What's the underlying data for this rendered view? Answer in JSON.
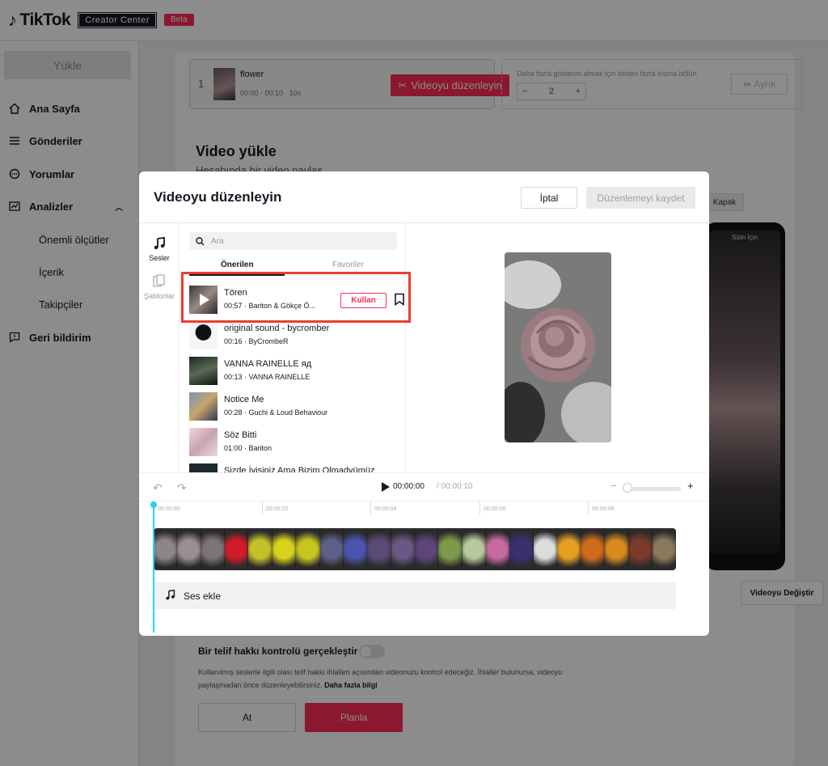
{
  "brand": {
    "name": "TikTok",
    "creator_center": "Creator Center",
    "beta": "Beta"
  },
  "sidebar": {
    "upload": "Yükle",
    "items": [
      {
        "label": "Ana Sayfa",
        "icon": "home-icon"
      },
      {
        "label": "Gönderiler",
        "icon": "list-icon"
      },
      {
        "label": "Yorumlar",
        "icon": "comment-icon"
      },
      {
        "label": "Analizler",
        "icon": "analytics-icon"
      },
      {
        "label": "Geri bildirim",
        "icon": "feedback-icon"
      }
    ],
    "analytics_sub": [
      "Önemli ölçütler",
      "İçerik",
      "Takipçiler"
    ]
  },
  "clip": {
    "index": "1",
    "name": "flower",
    "time": "00:00 - 00:10",
    "duration": "10s",
    "edit_button": "Videoyu düzenleyin",
    "split_hint": "Daha fazla gösterim almak için birden fazla kısma bölün",
    "split_count": "2",
    "split_button": "Ayrık"
  },
  "upload": {
    "title": "Video yükle",
    "subtitle": "Hesabında bir video paylaş",
    "cover_button": "Kapak",
    "phone_tab": "Sizin İçin",
    "replace_button": "Videoyu Değiştir",
    "copyright_title": "Bir telif hakkı kontrolü gerçekleştir",
    "copyright_desc": "Kullanılmış seslerle ilgili olası telif hakkı ihlalleri açısından videonuzu kontrol edeceğiz. İhlaller bulunursa, videoyu paylaşmadan önce düzenleyebilirsiniz.",
    "copyright_link": "Daha fazla bilgi",
    "discard": "At",
    "post": "Planla"
  },
  "modal": {
    "title": "Videoyu düzenleyin",
    "cancel": "İptal",
    "save": "Düzenlemeyi kaydet",
    "rail": {
      "sounds": "Sesler",
      "templates": "Şablonlar"
    },
    "search_placeholder": "Ara",
    "tabs": {
      "recommended": "Önerilen",
      "favorites": "Favoriler"
    },
    "use_button": "Kullan",
    "songs": [
      {
        "title": "Tören",
        "meta": "00:57 · Bariton & Gökçe Ö..."
      },
      {
        "title": "original sound - bycromber",
        "meta": "00:16 · ByCrombeR"
      },
      {
        "title": "VANNA RAINELLE яд",
        "meta": "00:13 · VANNA RAINELLE"
      },
      {
        "title": "Notice Me",
        "meta": "00:28 · Guchi & Loud Behaviour"
      },
      {
        "title": "Söz Bitti",
        "meta": "01:00 · Bariton"
      },
      {
        "title": "Sizde İyisiniz Ama Bizim Olmadyümüz",
        "meta": ""
      }
    ],
    "time_current": "00:00:00",
    "time_total": "00:00:10",
    "ticks": [
      "00:00:00",
      "00:00:02",
      "00:00:04",
      "00:00:06",
      "00:00:08"
    ],
    "add_sound": "Ses ekle",
    "frame_colors": [
      "#8d8587",
      "#9a8e90",
      "#7c7475",
      "#d11a2a",
      "#c4c02a",
      "#d8d21c",
      "#c9c51f",
      "#5d5f88",
      "#4b55b0",
      "#5b4b78",
      "#6b5684",
      "#5b4579",
      "#7c9a4a",
      "#b7c99a",
      "#c86aa0",
      "#3b2f72",
      "#dcdcdc",
      "#e5a01f",
      "#d06b1a",
      "#d88a1f",
      "#7d3a2a",
      "#8a7a5b"
    ]
  },
  "colors": {
    "accent": "#fe2c55",
    "playhead": "#20d5ec",
    "highlight": "#ee3b33"
  }
}
